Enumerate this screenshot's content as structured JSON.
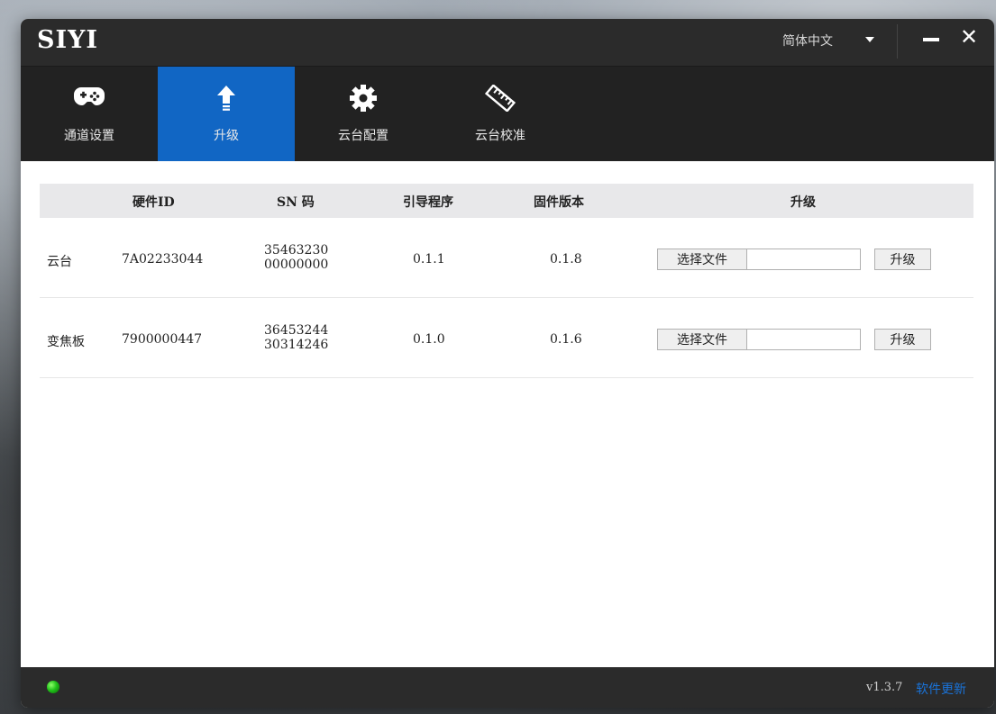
{
  "app": {
    "brand": "SIYI",
    "language": "简体中文"
  },
  "nav": {
    "tabs": [
      {
        "label": "通道设置",
        "icon": "gamepad-icon"
      },
      {
        "label": "升级",
        "icon": "upload-arrow-icon",
        "active": true
      },
      {
        "label": "云台配置",
        "icon": "gear-icon"
      },
      {
        "label": "云台校准",
        "icon": "ruler-icon"
      }
    ]
  },
  "table": {
    "headers": {
      "hardware_id": "硬件ID",
      "sn": "SN 码",
      "bootloader": "引导程序",
      "firmware": "固件版本",
      "upgrade": "升级"
    },
    "rows": [
      {
        "name": "云台",
        "hardware_id": "7A02233044",
        "sn_line1": "35463230",
        "sn_line2": "00000000",
        "bootloader": "0.1.1",
        "firmware": "0.1.8",
        "select_file_label": "选择文件",
        "file_value": "",
        "upgrade_label": "升级"
      },
      {
        "name": "变焦板",
        "hardware_id": "7900000447",
        "sn_line1": "36453244",
        "sn_line2": "30314246",
        "bootloader": "0.1.0",
        "firmware": "0.1.6",
        "select_file_label": "选择文件",
        "file_value": "",
        "upgrade_label": "升级"
      }
    ]
  },
  "footer": {
    "version": "v1.3.7",
    "update_link": "软件更新"
  },
  "colors": {
    "accent": "#1166c4",
    "titlebar": "#2b2b2b",
    "navbar": "#222222",
    "status_led": "#21c21a",
    "link": "#1a73d9"
  }
}
